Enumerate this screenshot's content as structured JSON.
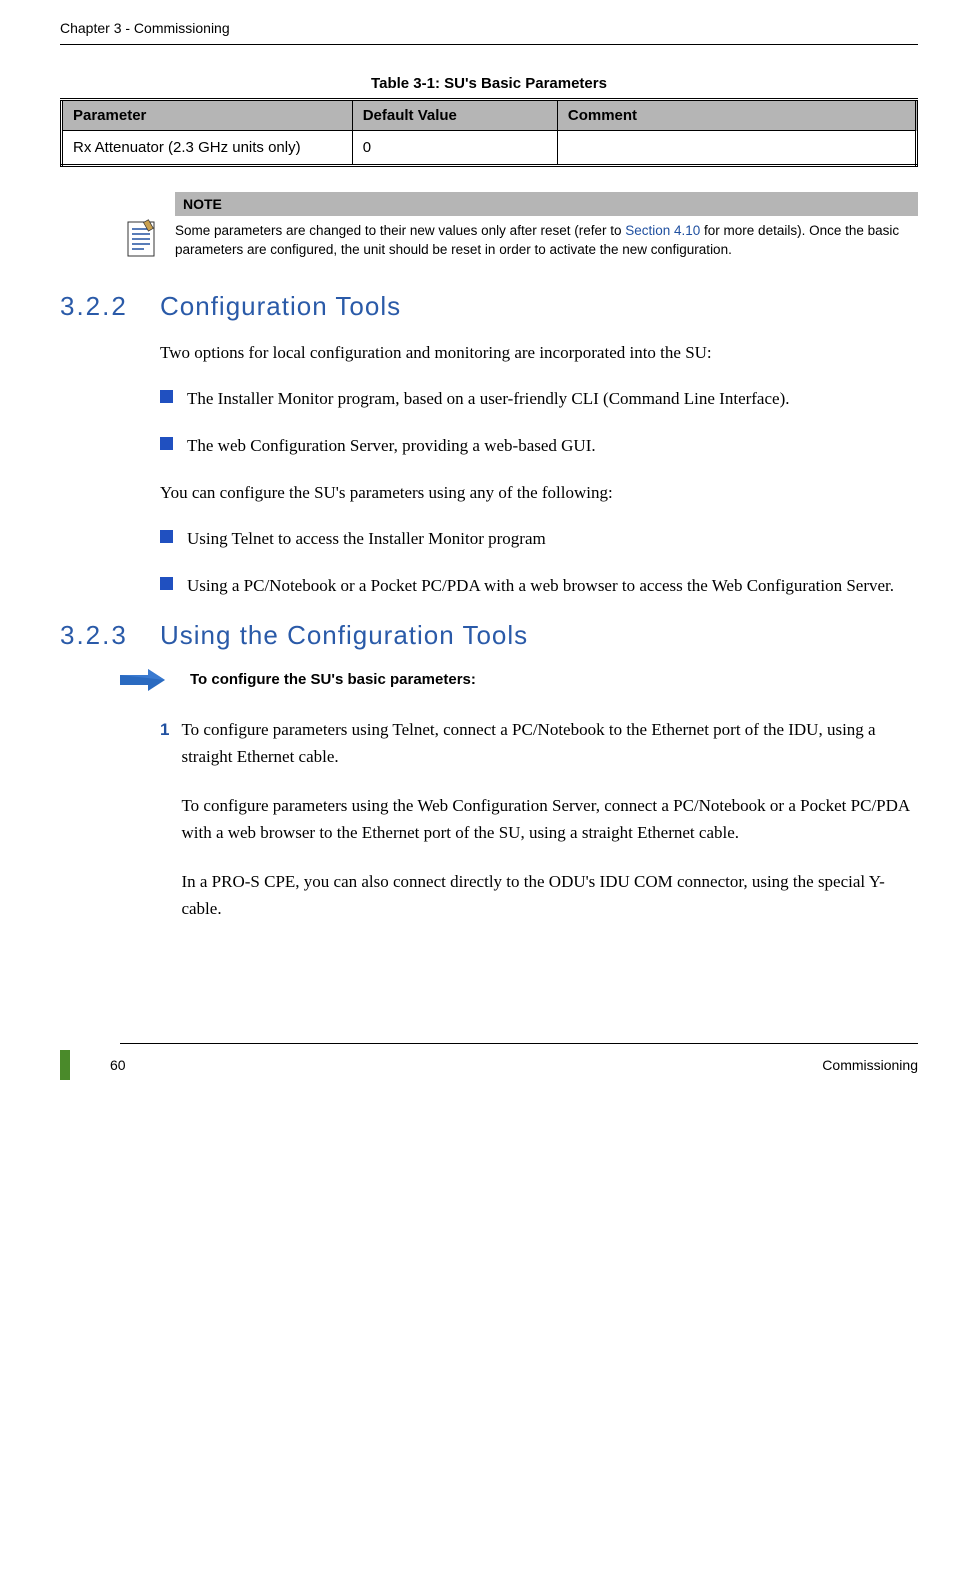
{
  "header": {
    "chapter": "Chapter 3 - Commissioning"
  },
  "table": {
    "caption": "Table 3-1: SU's Basic Parameters",
    "headers": {
      "param": "Parameter",
      "default": "Default Value",
      "comment": "Comment"
    },
    "rows": [
      {
        "param": "Rx Attenuator (2.3 GHz units only)",
        "default": "0",
        "comment": ""
      }
    ]
  },
  "note": {
    "label": "NOTE",
    "text_before": "Some parameters are changed to their new values only after reset (refer to ",
    "link": "Section 4.10",
    "text_after": " for more details). Once the basic parameters are configured, the unit should be reset in order to activate the new configuration."
  },
  "sections": {
    "s322": {
      "num": "3.2.2",
      "title": "Configuration Tools"
    },
    "s323": {
      "num": "3.2.3",
      "title": "Using the Configuration Tools"
    }
  },
  "body": {
    "intro322": "Two options for local configuration and monitoring are incorporated into the SU:",
    "bullets1": [
      "The Installer Monitor program, based on a user-friendly CLI (Command Line Interface).",
      "The web Configuration Server, providing a web-based GUI."
    ],
    "line2": "You can configure the SU's parameters using any of the following:",
    "bullets2": [
      "Using Telnet to access the Installer Monitor program",
      "Using a PC/Notebook or a Pocket PC/PDA with a web browser to access the Web Configuration Server."
    ]
  },
  "procedure": {
    "title": "To configure the SU's basic parameters:",
    "step1_num": "1",
    "step1_para1": "To configure parameters using Telnet, connect a PC/Notebook to the Ethernet port of the IDU, using a straight Ethernet cable.",
    "step1_para2": "To configure parameters using the Web Configuration Server, connect a PC/Notebook or a Pocket PC/PDA with a web browser to the Ethernet port of the SU, using a straight Ethernet cable.",
    "step1_para3": "In a PRO-S CPE, you can also connect directly to the ODU's IDU COM connector, using the special Y-cable."
  },
  "footer": {
    "page": "60",
    "title": "Commissioning"
  }
}
